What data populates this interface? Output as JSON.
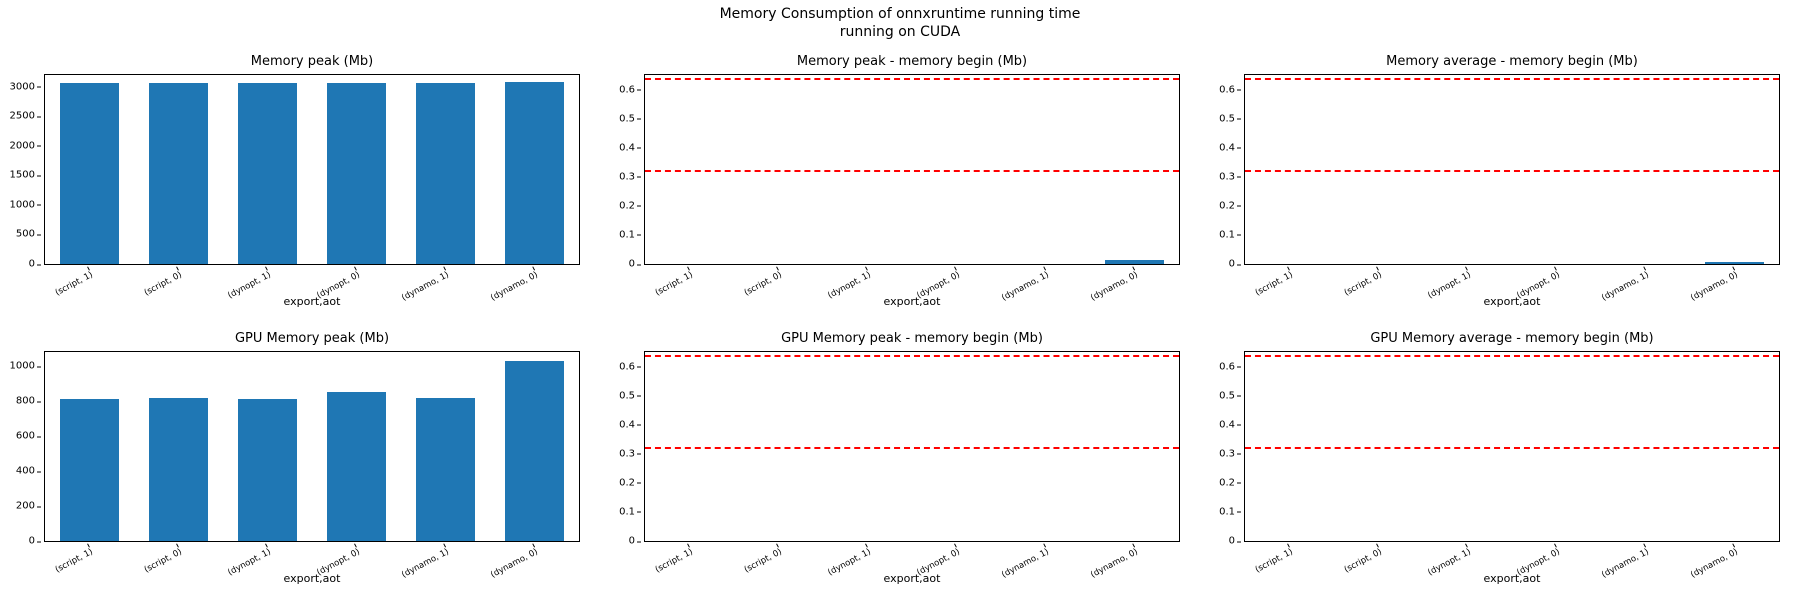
{
  "suptitle_line1": "Memory Consumption of onnxruntime running time",
  "suptitle_line2": "running on CUDA",
  "xlabel": "export,aot",
  "categories": [
    "(script, 1)",
    "(script, 0)",
    "(dynopt, 1)",
    "(dynopt, 0)",
    "(dynamo, 1)",
    "(dynamo, 0)"
  ],
  "chart_data": [
    {
      "type": "bar",
      "title": "Memory peak (Mb)",
      "categories": [
        "(script, 1)",
        "(script, 0)",
        "(dynopt, 1)",
        "(dynopt, 0)",
        "(dynamo, 1)",
        "(dynamo, 0)"
      ],
      "values": [
        3060,
        3060,
        3060,
        3070,
        3070,
        3080
      ],
      "ylim": [
        0,
        3200
      ],
      "yticks": [
        0,
        500,
        1000,
        1500,
        2000,
        2500,
        3000
      ],
      "xlabel": "export,aot",
      "hlines": []
    },
    {
      "type": "bar",
      "title": "Memory peak - memory begin (Mb)",
      "categories": [
        "(script, 1)",
        "(script, 0)",
        "(dynopt, 1)",
        "(dynopt, 0)",
        "(dynamo, 1)",
        "(dynamo, 0)"
      ],
      "values": [
        0,
        0,
        0,
        0,
        0,
        0.014
      ],
      "ylim": [
        0,
        0.65
      ],
      "yticks": [
        0.0,
        0.1,
        0.2,
        0.3,
        0.4,
        0.5,
        0.6
      ],
      "xlabel": "export,aot",
      "hlines": [
        0.316,
        0.632
      ]
    },
    {
      "type": "bar",
      "title": "Memory average - memory begin (Mb)",
      "categories": [
        "(script, 1)",
        "(script, 0)",
        "(dynopt, 1)",
        "(dynopt, 0)",
        "(dynamo, 1)",
        "(dynamo, 0)"
      ],
      "values": [
        0,
        0,
        0,
        0,
        0,
        0.006
      ],
      "ylim": [
        0,
        0.65
      ],
      "yticks": [
        0.0,
        0.1,
        0.2,
        0.3,
        0.4,
        0.5,
        0.6
      ],
      "xlabel": "export,aot",
      "hlines": [
        0.316,
        0.632
      ]
    },
    {
      "type": "bar",
      "title": "GPU Memory peak (Mb)",
      "categories": [
        "(script, 1)",
        "(script, 0)",
        "(dynopt, 1)",
        "(dynopt, 0)",
        "(dynamo, 1)",
        "(dynamo, 0)"
      ],
      "values": [
        810,
        815,
        810,
        850,
        815,
        1030
      ],
      "ylim": [
        0,
        1080
      ],
      "yticks": [
        0,
        200,
        400,
        600,
        800,
        1000
      ],
      "xlabel": "export,aot",
      "hlines": []
    },
    {
      "type": "bar",
      "title": "GPU Memory peak - memory begin (Mb)",
      "categories": [
        "(script, 1)",
        "(script, 0)",
        "(dynopt, 1)",
        "(dynopt, 0)",
        "(dynamo, 1)",
        "(dynamo, 0)"
      ],
      "values": [
        0,
        0,
        0,
        0,
        0,
        0
      ],
      "ylim": [
        0,
        0.65
      ],
      "yticks": [
        0.0,
        0.1,
        0.2,
        0.3,
        0.4,
        0.5,
        0.6
      ],
      "xlabel": "export,aot",
      "hlines": [
        0.316,
        0.632
      ]
    },
    {
      "type": "bar",
      "title": "GPU Memory average - memory begin (Mb)",
      "categories": [
        "(script, 1)",
        "(script, 0)",
        "(dynopt, 1)",
        "(dynopt, 0)",
        "(dynamo, 1)",
        "(dynamo, 0)"
      ],
      "values": [
        0,
        0,
        0,
        0,
        0,
        0
      ],
      "ylim": [
        0,
        0.65
      ],
      "yticks": [
        0.0,
        0.1,
        0.2,
        0.3,
        0.4,
        0.5,
        0.6
      ],
      "xlabel": "export,aot",
      "hlines": [
        0.316,
        0.632
      ]
    }
  ]
}
